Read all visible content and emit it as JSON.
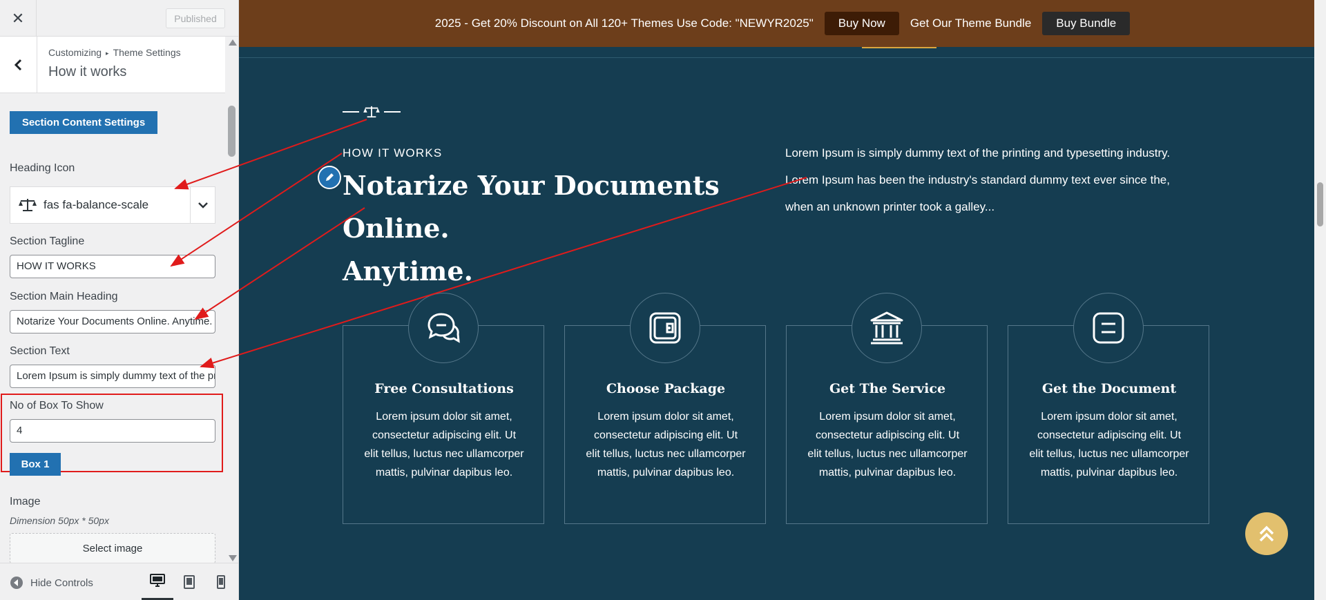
{
  "customizer": {
    "close_icon": "close-icon",
    "publish_label": "Published",
    "breadcrumb": {
      "root": "Customizing",
      "parent": "Theme Settings"
    },
    "panel_title": "How it works",
    "section_button": "Section Content Settings",
    "heading_icon": {
      "label": "Heading Icon",
      "value": "fas fa-balance-scale"
    },
    "tagline": {
      "label": "Section Tagline",
      "value": "HOW IT WORKS"
    },
    "main_heading": {
      "label": "Section Main Heading",
      "value": "Notarize Your Documents Online. Anytime."
    },
    "section_text": {
      "label": "Section Text",
      "value": "Lorem Ipsum is simply dummy text of the printing and typesetting industry."
    },
    "box_count": {
      "label": "No of Box To Show",
      "value": "4"
    },
    "box_button": "Box 1",
    "image": {
      "label": "Image",
      "dimension_note": "Dimension 50px * 50px",
      "select_label": "Select image"
    },
    "footer": {
      "hide_controls": "Hide Controls"
    }
  },
  "preview": {
    "promo": {
      "text": "2025 - Get 20% Discount on All 120+ Themes Use Code: \"NEWYR2025\"",
      "buy_now": "Buy Now",
      "bundle_text": "Get Our Theme Bundle",
      "buy_bundle": "Buy Bundle"
    },
    "section": {
      "tagline": "HOW IT WORKS",
      "heading_line1": "Notarize Your Documents Online.",
      "heading_line2": "Anytime.",
      "text_line1": "Lorem Ipsum is simply dummy text of the printing and typesetting industry.",
      "text_line2": "Lorem Ipsum has been the industry's standard dummy text ever since the,",
      "text_line3": "when an unknown printer took a galley...",
      "boxes": [
        {
          "icon": "chat-bubbles-icon",
          "title": "Free Consultations",
          "text": "Lorem ipsum dolor sit amet, consectetur adipiscing elit. Ut elit tellus, luctus nec ullamcorper mattis, pulvinar dapibus leo."
        },
        {
          "icon": "wallet-icon",
          "title": "Choose Package",
          "text": "Lorem ipsum dolor sit amet, consectetur adipiscing elit. Ut elit tellus, luctus nec ullamcorper mattis, pulvinar dapibus leo."
        },
        {
          "icon": "bank-icon",
          "title": "Get The Service",
          "text": "Lorem ipsum dolor sit amet, consectetur adipiscing elit. Ut elit tellus, luctus nec ullamcorper mattis, pulvinar dapibus leo."
        },
        {
          "icon": "document-icon",
          "title": "Get the Document",
          "text": "Lorem ipsum dolor sit amet, consectetur adipiscing elit. Ut elit tellus, luctus nec ullamcorper mattis, pulvinar dapibus leo."
        }
      ]
    }
  },
  "colors": {
    "section_bg": "#153d51",
    "promo_bg": "#6d3e1b",
    "accent_gold": "#e2c06e",
    "wp_blue": "#2271b1",
    "annotation_red": "#e01b1b"
  }
}
